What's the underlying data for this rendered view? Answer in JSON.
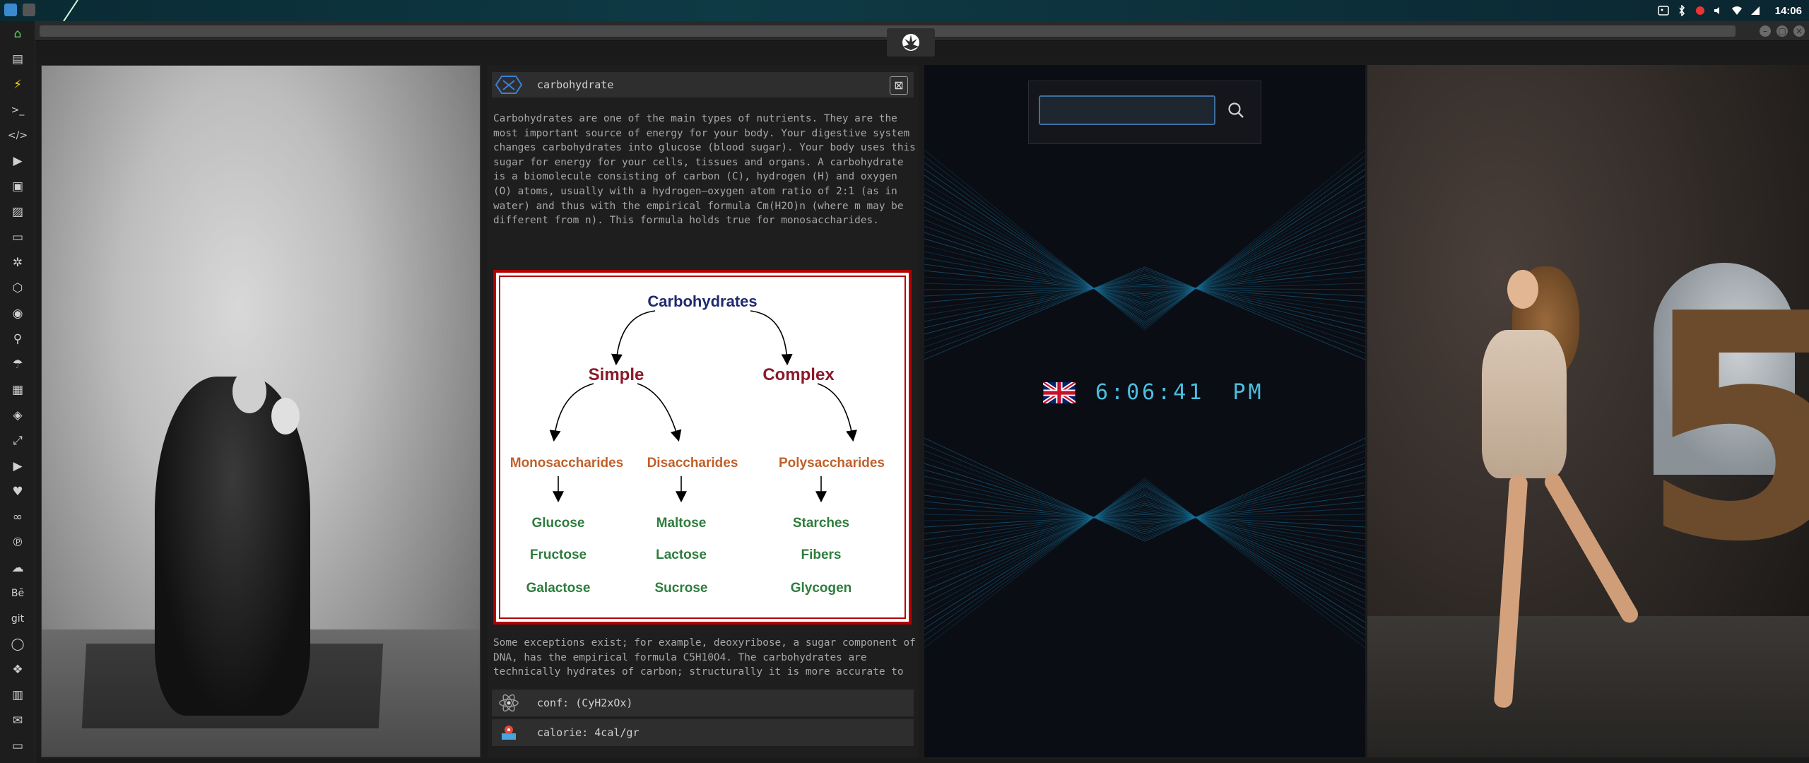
{
  "system": {
    "clock": "14:06"
  },
  "sidebar": {
    "items": [
      {
        "icon": "home-icon"
      },
      {
        "icon": "document-icon"
      },
      {
        "icon": "bolt-icon"
      },
      {
        "icon": "terminal-icon",
        "label": ">_"
      },
      {
        "icon": "code-icon",
        "label": "</>"
      },
      {
        "icon": "play-icon"
      },
      {
        "icon": "media-icon"
      },
      {
        "icon": "image-icon"
      },
      {
        "icon": "card-icon"
      },
      {
        "icon": "settings-icon"
      },
      {
        "icon": "network-icon"
      },
      {
        "icon": "globe-icon"
      },
      {
        "icon": "search-icon"
      },
      {
        "icon": "umbrella-icon"
      },
      {
        "icon": "contacts-icon"
      },
      {
        "icon": "tag-icon"
      },
      {
        "icon": "expand-icon"
      },
      {
        "icon": "youtube-icon"
      },
      {
        "icon": "heart-icon"
      },
      {
        "icon": "lastfm-icon"
      },
      {
        "icon": "pinterest-icon"
      },
      {
        "icon": "cloud-icon"
      },
      {
        "icon": "behance-icon",
        "label": "Bē"
      },
      {
        "icon": "git-icon",
        "label": "git"
      },
      {
        "icon": "github-icon"
      },
      {
        "icon": "cubes-icon"
      },
      {
        "icon": "map-icon"
      },
      {
        "icon": "mail-icon"
      },
      {
        "icon": "monitor-icon"
      }
    ]
  },
  "info": {
    "title": "carbohydrate",
    "paragraph1": "Carbohydrates are one of the main types of nutrients. They are the most important source of energy for your body. Your digestive system changes carbohydrates into glucose (blood sugar). Your body uses this sugar for energy for your cells, tissues and organs. A carbohydrate is a biomolecule consisting of carbon (C), hydrogen (H) and oxygen (O) atoms, usually with a hydrogen–oxygen atom ratio of 2:1 (as in water) and thus with the empirical formula Cm(H2O)n (where m may be different from n). This formula holds true for monosaccharides.",
    "paragraph2": "Some exceptions exist; for example, deoxyribose, a sugar component of DNA, has the empirical formula C5H10O4. The carbohydrates are technically hydrates of carbon; structurally it is more accurate to view them as aldoses and ketoses.",
    "conf_label": "conf:",
    "conf_formula": "(CyH2xOx)",
    "calorie_label": "calorie:",
    "calorie_value": "4cal/gr"
  },
  "diagram": {
    "root": "Carbohydrates",
    "simple": "Simple",
    "complex": "Complex",
    "mono": "Monosaccharides",
    "di": "Disaccharides",
    "poly": "Polysaccharides",
    "mono_items": [
      "Glucose",
      "Fructose",
      "Galactose"
    ],
    "di_items": [
      "Maltose",
      "Lactose",
      "Sucrose"
    ],
    "poly_items": [
      "Starches",
      "Fibers",
      "Glycogen"
    ],
    "colors": {
      "root": "#1f2a6e",
      "level1": "#8a1a2a",
      "level2": "#c0602a",
      "leaf": "#2e7d3e"
    }
  },
  "search": {
    "value": ""
  },
  "clock_widget": {
    "time": "6:06:41",
    "ampm": "PM",
    "flag": "uk-flag-icon"
  }
}
